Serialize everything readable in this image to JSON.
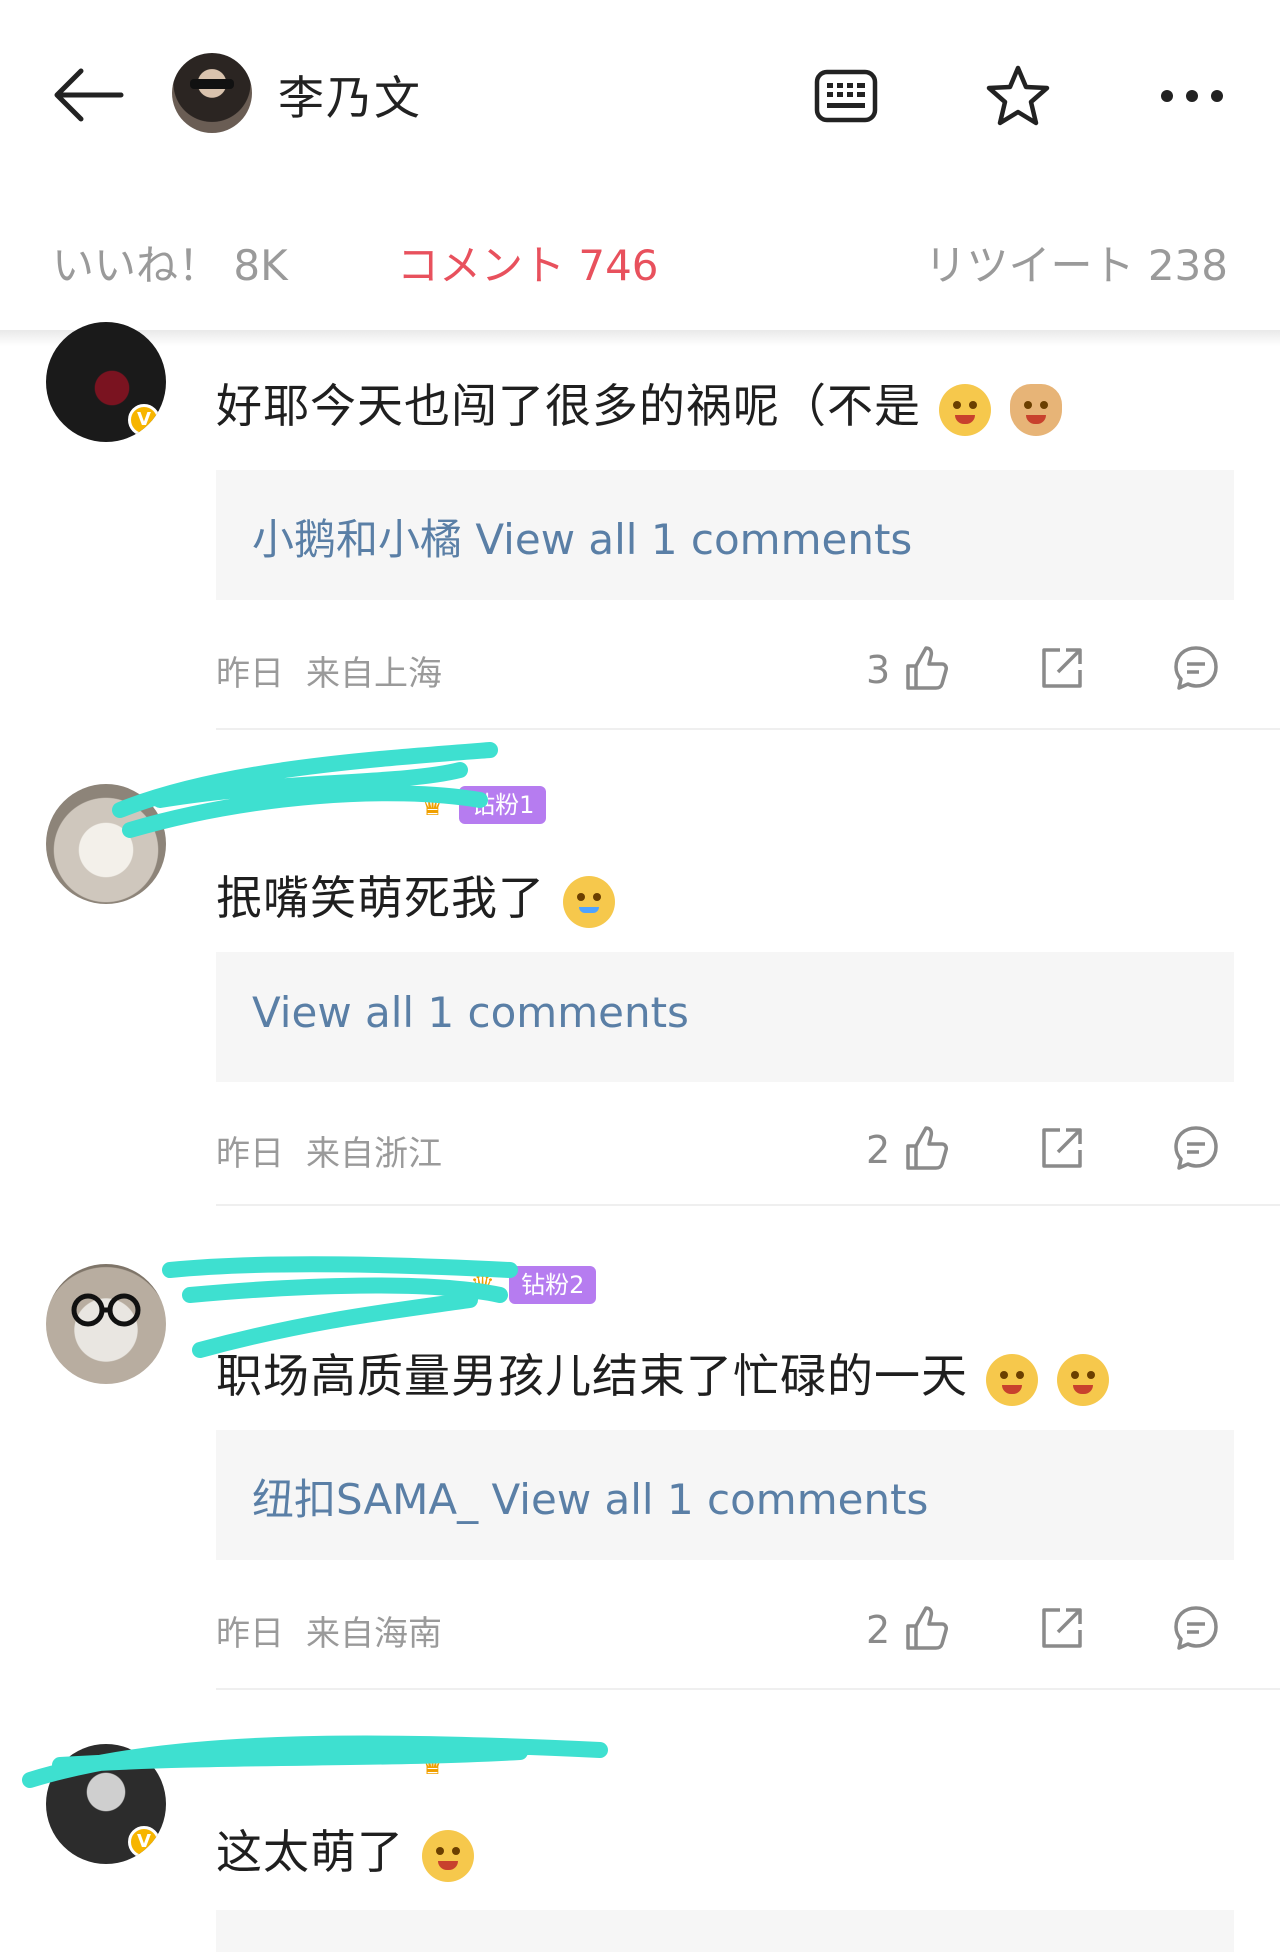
{
  "header": {
    "title": "李乃文",
    "back_icon": "back-arrow-icon",
    "keyboard_icon": "keyboard-icon",
    "star_icon": "star-icon",
    "more_icon": "more-icon"
  },
  "tabs": [
    {
      "label": "いいね！ 8K"
    },
    {
      "label": "コメント 746"
    },
    {
      "label": "リツイート 238"
    }
  ],
  "colors": {
    "accent": "#e8515d",
    "link": "#5a7fa6",
    "muted": "#9a9a9a",
    "scribble": "#3ee0d0",
    "badge": "#b67cf0"
  },
  "comments": [
    {
      "text": "好耶今天也闯了很多的祸呢（不是",
      "reply_prefix": "小鹅和小橘",
      "reply_link": "View all 1 comments",
      "time": "昨日",
      "location": "来自上海",
      "likes": "3"
    },
    {
      "badge": "钻粉1",
      "text": "抿嘴笑萌死我了",
      "reply_prefix": "",
      "reply_link": "View all 1 comments",
      "time": "昨日",
      "location": "来自浙江",
      "likes": "2"
    },
    {
      "badge": "钻粉2",
      "text": "职场高质量男孩儿结束了忙碌的一天",
      "reply_prefix": "纽扣SAMA_",
      "reply_link": "View all 1 comments",
      "time": "昨日",
      "location": "来自海南",
      "likes": "2"
    },
    {
      "text": "这太萌了"
    }
  ]
}
